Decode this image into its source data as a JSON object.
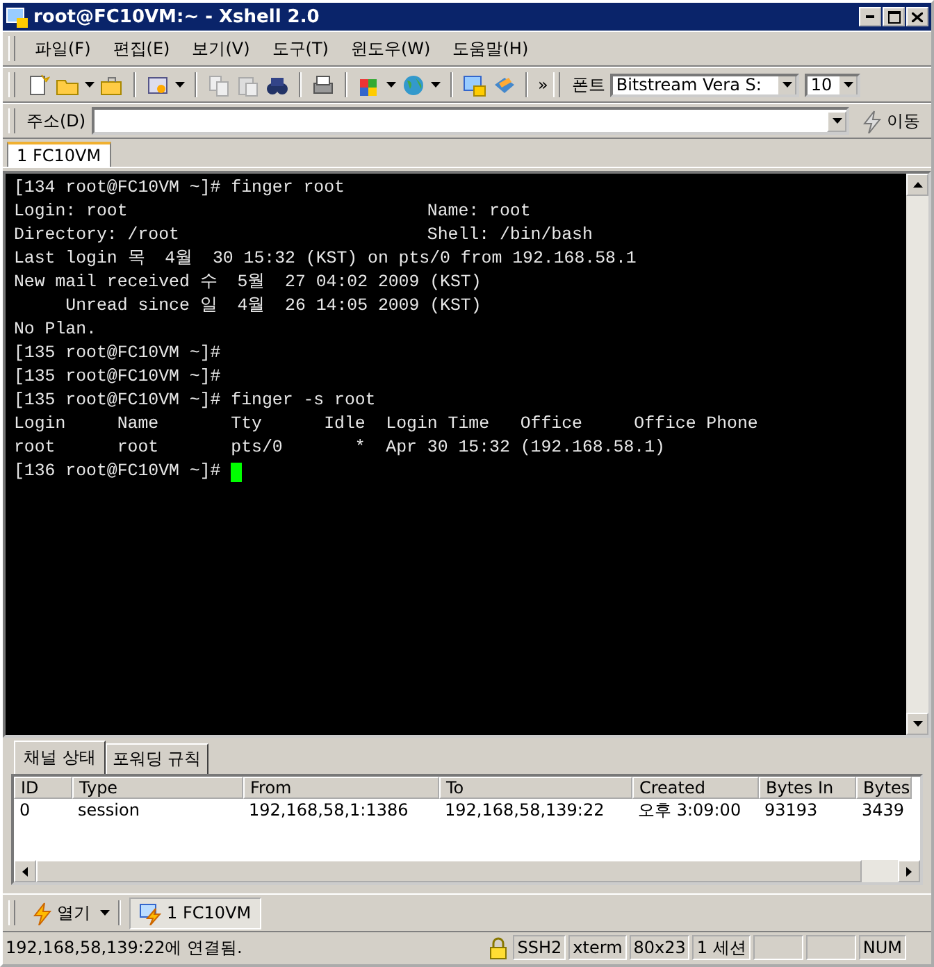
{
  "window": {
    "title": "root@FC10VM:~ - Xshell 2.0"
  },
  "menu": [
    "파일(F)",
    "편집(E)",
    "보기(V)",
    "도구(T)",
    "윈도우(W)",
    "도움말(H)"
  ],
  "toolbar": {
    "font_label": "폰트",
    "font_value": "Bitstream Vera S:",
    "size_value": "10",
    "more": "»"
  },
  "address": {
    "label": "주소(D)",
    "go": "이동"
  },
  "session_tabs": [
    {
      "label": "1 FC10VM",
      "selected": true
    }
  ],
  "terminal": {
    "lines": [
      "[134 root@FC10VM ~]# finger root",
      "Login: root                             Name: root",
      "Directory: /root                        Shell: /bin/bash",
      "Last login 목  4월  30 15:32 (KST) on pts/0 from 192.168.58.1",
      "New mail received 수  5월  27 04:02 2009 (KST)",
      "     Unread since 일  4월  26 14:05 2009 (KST)",
      "No Plan.",
      "[135 root@FC10VM ~]#",
      "[135 root@FC10VM ~]#",
      "[135 root@FC10VM ~]# finger -s root",
      "Login     Name       Tty      Idle  Login Time   Office     Office Phone",
      "root      root       pts/0       *  Apr 30 15:32 (192.168.58.1)",
      "[136 root@FC10VM ~]# "
    ],
    "cursor": true
  },
  "panel_tabs": [
    {
      "label": "채널 상태",
      "selected": true
    },
    {
      "label": "포워딩 규칙",
      "selected": false
    }
  ],
  "table": {
    "columns": [
      "ID",
      "Type",
      "From",
      "To",
      "Created",
      "Bytes In",
      "Bytes"
    ],
    "rows": [
      [
        "0",
        "session",
        "192,168,58,1:1386",
        "192,168,58,139:22",
        "오후 3:09:00",
        "93193",
        "3439"
      ]
    ]
  },
  "session_bar": {
    "open": "열기",
    "items": [
      {
        "label": "1 FC10VM",
        "selected": true
      }
    ]
  },
  "status_bar": {
    "message": "192,168,58,139:22에 연결됨.",
    "cells": [
      "SSH2",
      "xterm",
      "80x23",
      "1 세션",
      "",
      "",
      "NUM"
    ]
  }
}
